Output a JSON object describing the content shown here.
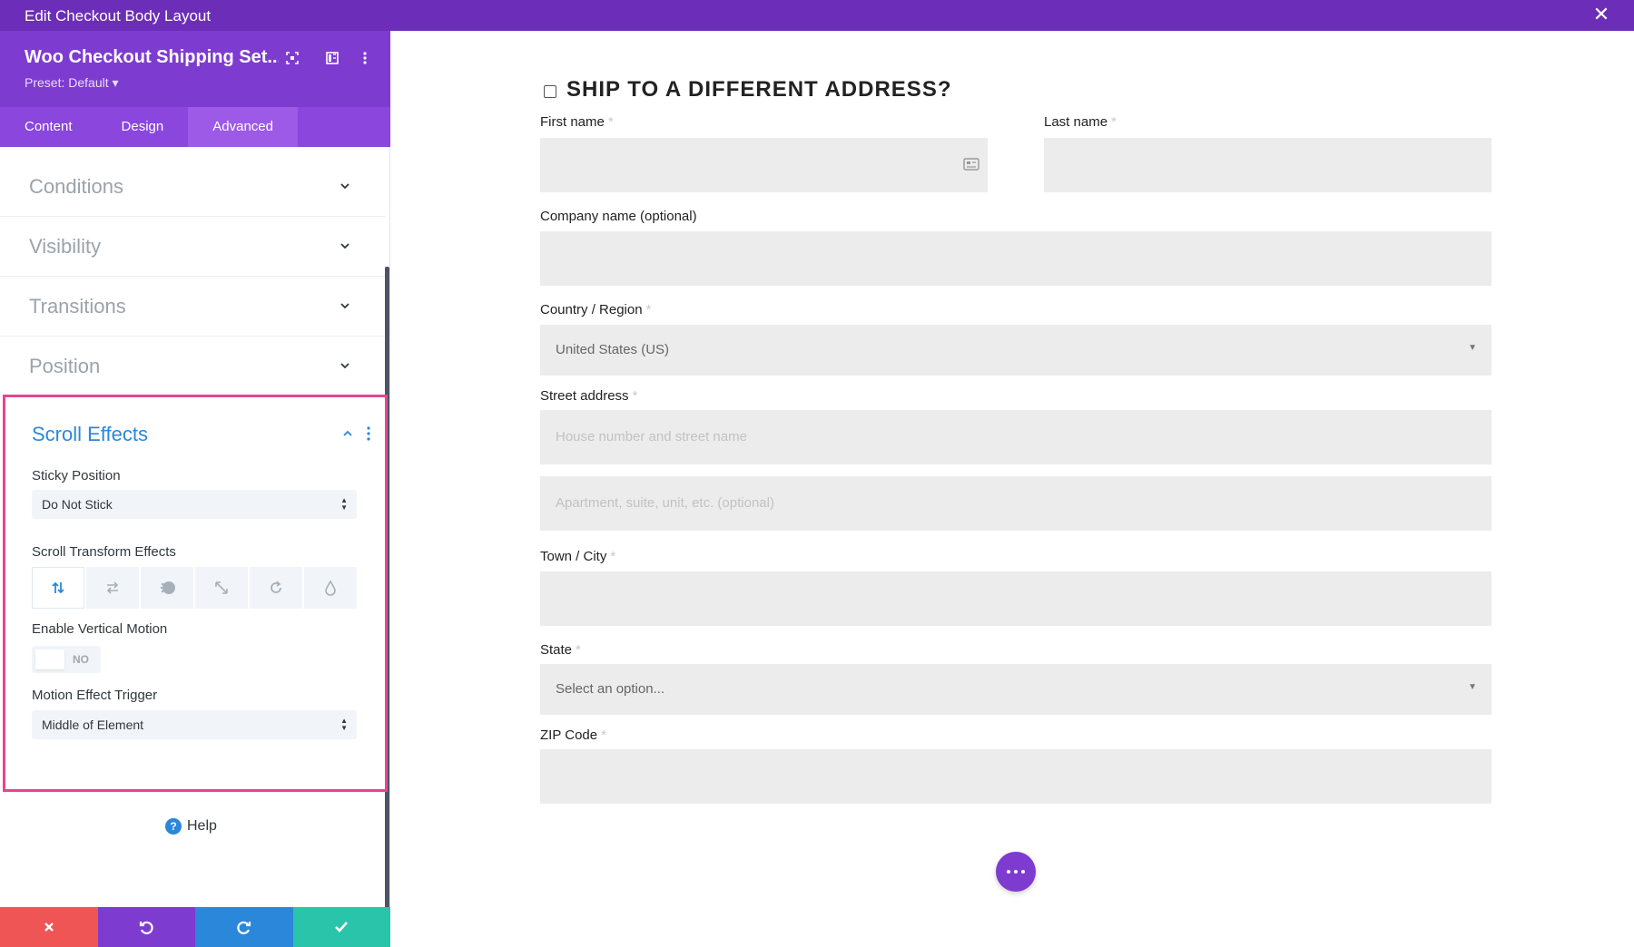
{
  "window": {
    "title": "Edit Checkout Body Layout",
    "close_icon": "close-icon"
  },
  "panel": {
    "module_title": "Woo Checkout Shipping Set...",
    "preset": "Preset: Default ▾",
    "tabs": [
      {
        "label": "Content"
      },
      {
        "label": "Design"
      },
      {
        "label": "Advanced",
        "active": true
      }
    ],
    "sections": [
      {
        "title": "Conditions"
      },
      {
        "title": "Visibility"
      },
      {
        "title": "Transitions"
      },
      {
        "title": "Position"
      }
    ],
    "scroll_effects": {
      "title": "Scroll Effects",
      "sticky_label": "Sticky Position",
      "sticky_value": "Do Not Stick",
      "transform_label": "Scroll Transform Effects",
      "effects": [
        "vertical-motion-icon",
        "horizontal-motion-icon",
        "fading-icon",
        "scaling-icon",
        "rotating-icon",
        "blur-icon"
      ],
      "vertical_label": "Enable Vertical Motion",
      "toggle_text": "NO",
      "trigger_label": "Motion Effect Trigger",
      "trigger_value": "Middle of Element"
    },
    "help": "Help"
  },
  "colors": {
    "purple_dark": "#6c2eb9",
    "purple": "#7e3bd0",
    "accent_blue": "#2b87da",
    "highlight_pink": "#e84393",
    "red": "#ef5555",
    "violet": "#7e3bd0",
    "blue": "#2b87da",
    "teal": "#29c4a9"
  },
  "form": {
    "heading": "SHIP TO A DIFFERENT ADDRESS?",
    "first_name": "First name",
    "last_name": "Last name",
    "company": "Company name (optional)",
    "country_label": "Country / Region",
    "country_value": "United States (US)",
    "street_label": "Street address",
    "street_ph1": "House number and street name",
    "street_ph2": "Apartment, suite, unit, etc. (optional)",
    "city": "Town / City",
    "state_label": "State",
    "state_ph": "Select an option...",
    "zip": "ZIP Code",
    "req": "*"
  }
}
